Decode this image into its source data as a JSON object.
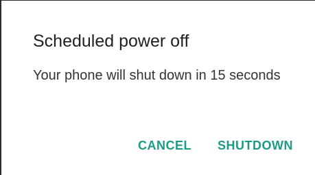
{
  "dialog": {
    "title": "Scheduled power off",
    "message": "Your phone will shut down in 15 seconds",
    "cancel_label": "CANCEL",
    "shutdown_label": "SHUTDOWN"
  },
  "colors": {
    "accent": "#1b9b86",
    "title_text": "#212121",
    "body_text": "#333333",
    "background": "#ffffff"
  }
}
